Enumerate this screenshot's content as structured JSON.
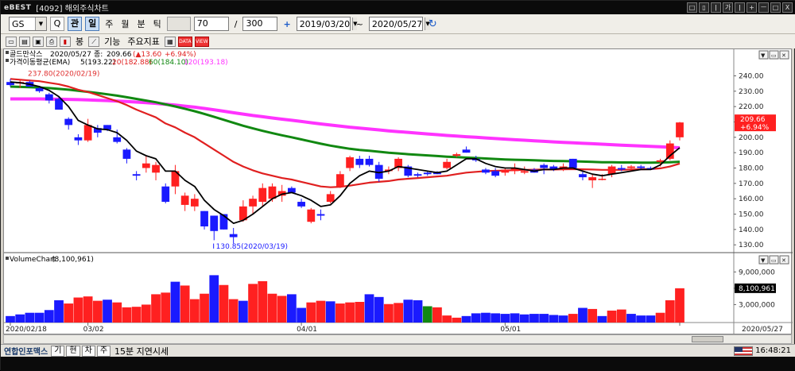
{
  "window": {
    "logo": "eBEST",
    "title": "[4092] 해외주식차트",
    "buttons": [
      "□",
      "▯",
      "ǀ",
      "가",
      "ǀ",
      "+",
      "ㅡ",
      "□",
      "X"
    ]
  },
  "toolbar": {
    "symbol": "GS",
    "search": "Q",
    "mode_gwan": "관",
    "period_day": "일",
    "period_week": "주",
    "period_month": "월",
    "period_min": "분",
    "period_tick": "틱",
    "count": "70",
    "slash": "/",
    "total": "300",
    "start_date": "2019/03/20",
    "end_date": "2020/05/27",
    "tilde": "~",
    "plus": "+",
    "refresh": "↻"
  },
  "toolbar2": {
    "candle_label": "봉",
    "func_label": "기능",
    "indicator_label": "주요지표",
    "ico_data": "DATA",
    "ico_view": "VIEW"
  },
  "chart_data": [
    {
      "type": "candlestick",
      "title": "골드만삭스",
      "info": {
        "date": "2020/05/27",
        "close_label": "종:",
        "close": "209.66",
        "change": "(▲13.60",
        "pct": "+6.94%)"
      },
      "legend": {
        "label": "가격이동평균(EMA)",
        "ema5": "5(193.22)",
        "ema20": "20(182.88)",
        "ema60": "60(184.10)",
        "ema120": "120(193.18)"
      },
      "high_annotation": "237.80(2020/02/19)",
      "low_annotation": "130.85(2020/03/19)",
      "current_price_box": [
        "209.66",
        "+6.94%"
      ],
      "ylim": [
        127,
        248
      ],
      "y_ticks": [
        240,
        230,
        220,
        210,
        200,
        190,
        180,
        170,
        160,
        150,
        140,
        130
      ],
      "y_tick_labels": [
        "240.00",
        "230.00",
        "220.00",
        "210.00",
        "200.00",
        "190.00",
        "180.00",
        "170.00",
        "160.00",
        "150.00",
        "140.00",
        "130.00"
      ],
      "x_labels": [
        {
          "label": "2020/02/18",
          "index": 0
        },
        {
          "label": "03/02",
          "index": 8
        },
        {
          "label": "04/01",
          "index": 30
        },
        {
          "label": "05/01",
          "index": 51
        },
        {
          "label": "2020/05/27",
          "index": 69
        }
      ],
      "candles": [
        [
          236,
          238,
          233,
          234
        ],
        [
          235,
          237.8,
          232,
          236
        ],
        [
          236,
          237,
          233,
          233
        ],
        [
          232,
          233,
          229,
          230
        ],
        [
          228,
          229,
          222,
          224
        ],
        [
          225,
          227,
          218,
          218
        ],
        [
          212,
          213,
          205,
          208
        ],
        [
          200,
          202,
          195,
          198
        ],
        [
          198,
          212,
          197,
          208
        ],
        [
          206,
          208,
          200,
          203
        ],
        [
          208,
          208,
          204,
          205
        ],
        [
          200,
          205,
          196,
          197
        ],
        [
          192,
          193,
          183,
          186
        ],
        [
          176,
          178,
          172,
          175
        ],
        [
          180,
          188,
          177,
          183
        ],
        [
          177,
          184,
          172,
          182
        ],
        [
          168,
          170,
          157,
          158
        ],
        [
          168,
          182,
          163,
          178
        ],
        [
          156,
          164,
          152,
          162
        ],
        [
          155,
          163,
          152,
          160
        ],
        [
          152,
          152,
          140,
          142
        ],
        [
          149,
          149,
          133,
          139
        ],
        [
          150,
          150,
          140,
          140
        ],
        [
          137,
          141,
          130.85,
          135
        ],
        [
          146,
          159,
          145,
          155
        ],
        [
          155,
          162,
          150,
          160
        ],
        [
          158,
          170,
          155,
          167
        ],
        [
          160,
          170,
          158,
          168
        ],
        [
          162,
          169,
          158,
          165
        ],
        [
          167,
          168,
          164,
          164
        ],
        [
          158,
          160,
          154,
          155
        ],
        [
          145,
          154,
          144,
          153
        ],
        [
          150,
          153,
          146,
          149
        ],
        [
          158,
          165,
          157,
          163
        ],
        [
          168,
          178,
          167,
          176
        ],
        [
          180,
          188,
          178,
          187
        ],
        [
          186,
          188,
          180,
          182
        ],
        [
          186,
          188,
          181,
          182
        ],
        [
          182,
          184,
          171,
          173
        ],
        [
          178,
          181,
          176,
          179
        ],
        [
          180,
          187,
          178,
          186
        ],
        [
          181,
          182,
          174,
          175
        ],
        [
          176,
          177,
          174,
          175
        ],
        [
          177,
          178,
          175,
          176
        ],
        [
          177,
          178,
          176,
          176
        ],
        [
          180,
          186,
          179,
          184
        ],
        [
          188,
          190,
          187,
          189
        ],
        [
          192,
          194,
          190,
          190
        ],
        [
          186,
          188,
          184,
          185
        ],
        [
          179,
          180,
          176,
          177
        ],
        [
          178,
          180,
          174,
          175
        ],
        [
          177,
          180,
          175,
          179
        ],
        [
          178,
          183,
          176,
          180
        ],
        [
          177,
          181,
          176,
          178
        ],
        [
          179,
          180,
          177,
          177
        ],
        [
          182,
          183,
          176,
          180
        ],
        [
          181,
          182,
          178,
          179
        ],
        [
          180,
          183,
          178,
          181
        ],
        [
          186,
          186,
          180,
          180
        ],
        [
          176,
          178,
          172,
          174
        ],
        [
          172,
          176,
          167,
          174
        ],
        [
          173,
          176,
          172,
          173
        ],
        [
          176,
          182,
          174,
          181
        ],
        [
          180,
          182,
          178,
          179
        ],
        [
          180,
          182,
          178,
          181
        ],
        [
          181,
          182,
          179,
          180
        ],
        [
          180,
          181,
          179,
          179
        ],
        [
          184,
          186,
          181,
          185
        ],
        [
          186,
          198,
          185,
          196
        ],
        [
          200,
          210,
          198,
          209.66
        ]
      ],
      "ema5": [
        236,
        235.5,
        234.5,
        233,
        230.5,
        226.5,
        220,
        211,
        208,
        205.5,
        205,
        203,
        198,
        191,
        188,
        186,
        178,
        178,
        172,
        168,
        159,
        153,
        149,
        144,
        146,
        150,
        155,
        160,
        163,
        164,
        162,
        159,
        155,
        156,
        162,
        170,
        175,
        178,
        177,
        178,
        181,
        180,
        179,
        178,
        177,
        178,
        182,
        186,
        186,
        183,
        181,
        180,
        180,
        179,
        178,
        179,
        179,
        180,
        180,
        178,
        176,
        175,
        176,
        177,
        178,
        179,
        179,
        182,
        188,
        193.22
      ],
      "ema20": [
        238,
        237.5,
        237,
        236.5,
        235.5,
        234.5,
        233,
        231,
        229.5,
        227.5,
        225.5,
        223.5,
        221,
        218,
        215.5,
        213,
        209,
        206.5,
        203,
        200,
        196,
        192,
        188,
        184,
        181,
        178.5,
        176.5,
        175,
        173.5,
        172.5,
        171,
        169.5,
        168,
        167.5,
        167.8,
        168.5,
        169.5,
        170.5,
        171,
        171.5,
        172.5,
        173,
        173.5,
        174,
        174.5,
        175,
        176,
        177,
        177.5,
        178,
        178.2,
        178.4,
        178.6,
        178.8,
        178.9,
        179,
        179,
        179.2,
        179.3,
        179.2,
        179,
        178.8,
        178.8,
        178.8,
        179,
        179.2,
        179.3,
        179.8,
        181,
        182.88
      ],
      "ema60": [
        233,
        232.8,
        232.6,
        232.4,
        232,
        231.5,
        231,
        230.3,
        229.6,
        228.8,
        228,
        227.1,
        226.1,
        225,
        223.9,
        222.8,
        221.4,
        220.1,
        218.6,
        217,
        215.2,
        213.3,
        211.4,
        209.4,
        207.5,
        205.8,
        204.2,
        202.7,
        201.3,
        200,
        198.6,
        197.2,
        195.8,
        194.6,
        193.5,
        192.5,
        191.8,
        191.2,
        190.6,
        190,
        189.5,
        189,
        188.6,
        188.2,
        187.8,
        187.4,
        187.1,
        186.8,
        186.5,
        186.2,
        185.9,
        185.6,
        185.4,
        185.2,
        185,
        184.8,
        184.6,
        184.5,
        184.4,
        184.2,
        184,
        183.8,
        183.7,
        183.6,
        183.6,
        183.5,
        183.5,
        183.6,
        183.8,
        184.1
      ],
      "ema120": [
        225,
        225,
        225,
        225,
        224.9,
        224.8,
        224.7,
        224.5,
        224.3,
        224.1,
        223.9,
        223.6,
        223.3,
        222.9,
        222.5,
        222.1,
        221.5,
        221,
        220.3,
        219.6,
        218.8,
        217.9,
        217,
        216,
        215.1,
        214.2,
        213.4,
        212.6,
        211.8,
        211.1,
        210.3,
        209.5,
        208.7,
        208,
        207.3,
        206.6,
        206,
        205.4,
        204.8,
        204.2,
        203.7,
        203.2,
        202.7,
        202.2,
        201.7,
        201.2,
        200.8,
        200.4,
        200,
        199.6,
        199.2,
        198.8,
        198.4,
        198.1,
        197.7,
        197.4,
        197,
        196.7,
        196.4,
        196.1,
        195.8,
        195.5,
        195.2,
        194.9,
        194.6,
        194.3,
        194.1,
        193.8,
        193.5,
        193.18
      ]
    },
    {
      "type": "bar",
      "title": "VolumeChart",
      "value_label": "(8,100,961)",
      "current_box": "8,100,961",
      "ylim": [
        0,
        10500000
      ],
      "y_ticks": [
        9000000,
        6000000,
        3000000
      ],
      "y_tick_labels": [
        "9,000,000",
        "6,000,000",
        "3,000,000"
      ],
      "values": [
        900000,
        1200000,
        1500000,
        1500000,
        2000000,
        3800000,
        3200000,
        4300000,
        4500000,
        3700000,
        3900000,
        3400000,
        2500000,
        2600000,
        3000000,
        4900000,
        5200000,
        7200000,
        6500000,
        4000000,
        5000000,
        8400000,
        6600000,
        4000000,
        3700000,
        6800000,
        7300000,
        5000000,
        4600000,
        4900000,
        2400000,
        3400000,
        3700000,
        3600000,
        3200000,
        3400000,
        3500000,
        4900000,
        4400000,
        3100000,
        3300000,
        3900000,
        3800000,
        2700000,
        2500000,
        1000000,
        600000,
        900000,
        1400000,
        1500000,
        1400000,
        1300000,
        1400000,
        1200000,
        1300000,
        1300000,
        1100000,
        1000000,
        1300000,
        2400000,
        2200000,
        900000,
        1900000,
        2100000,
        1300000,
        1000000,
        1000000,
        1500000,
        3800000,
        6000000
      ],
      "colors": [
        "b",
        "b",
        "b",
        "b",
        "b",
        "b",
        "r",
        "r",
        "r",
        "r",
        "b",
        "r",
        "r",
        "r",
        "r",
        "r",
        "r",
        "b",
        "r",
        "r",
        "r",
        "b",
        "r",
        "r",
        "b",
        "r",
        "r",
        "r",
        "r",
        "b",
        "b",
        "r",
        "r",
        "b",
        "r",
        "r",
        "r",
        "b",
        "b",
        "r",
        "r",
        "b",
        "b",
        "g",
        "r",
        "r",
        "r",
        "b",
        "b",
        "b",
        "b",
        "b",
        "b",
        "b",
        "b",
        "b",
        "b",
        "b",
        "r",
        "b",
        "r",
        "b",
        "r",
        "r",
        "b",
        "b",
        "b",
        "r",
        "r",
        "r"
      ]
    }
  ],
  "statusbar": {
    "brand": "연합인포맥스",
    "btn1": "기",
    "btn2": "현",
    "btn3": "차",
    "btn4": "주",
    "delay_text": "15분 지연시세",
    "time": "16:48:21"
  },
  "colors": {
    "up": "#ff2020",
    "down": "#1a1aff",
    "ema5": "#000000",
    "ema20": "#e02020",
    "ema60": "#118811",
    "ema120": "#ff33ff"
  }
}
